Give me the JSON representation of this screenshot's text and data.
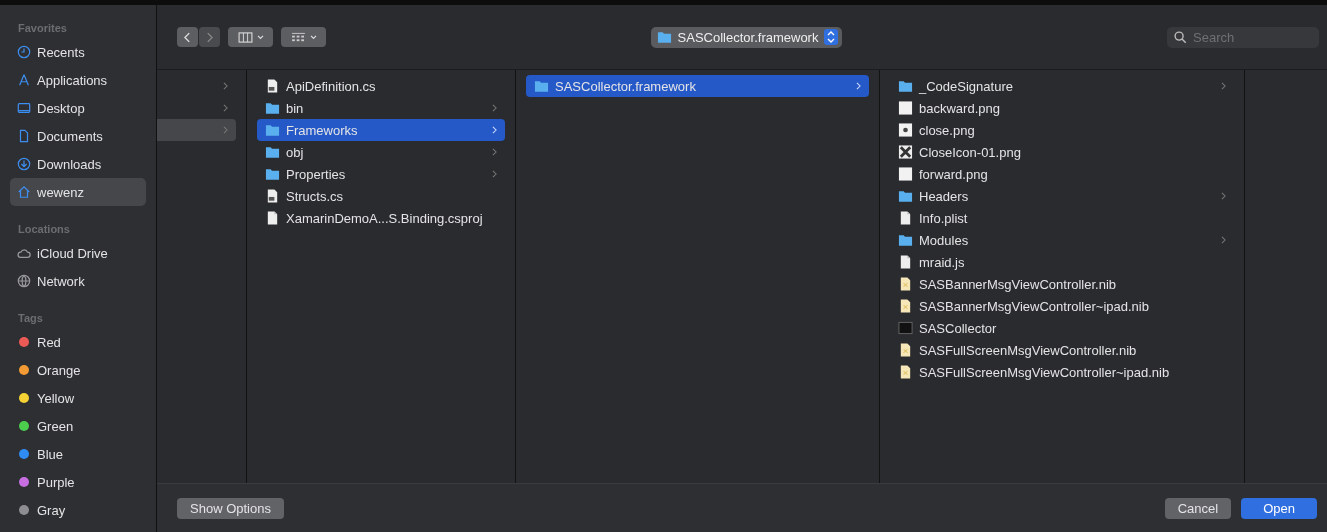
{
  "sidebar": {
    "sections": [
      {
        "title": "Favorites",
        "items": [
          {
            "label": "Recents",
            "kind": "clock",
            "selected": false
          },
          {
            "label": "Applications",
            "kind": "apps",
            "selected": false
          },
          {
            "label": "Desktop",
            "kind": "desktop",
            "selected": false
          },
          {
            "label": "Documents",
            "kind": "doc",
            "selected": false
          },
          {
            "label": "Downloads",
            "kind": "download",
            "selected": false
          },
          {
            "label": "wewenz",
            "kind": "home",
            "selected": true
          }
        ]
      },
      {
        "title": "Locations",
        "items": [
          {
            "label": "iCloud Drive",
            "kind": "cloud",
            "selected": false
          },
          {
            "label": "Network",
            "kind": "globe",
            "selected": false
          }
        ]
      },
      {
        "title": "Tags",
        "items": [
          {
            "label": "Red",
            "color": "#ec5a56",
            "selected": false
          },
          {
            "label": "Orange",
            "color": "#f29a33",
            "selected": false
          },
          {
            "label": "Yellow",
            "color": "#f5d133",
            "selected": false
          },
          {
            "label": "Green",
            "color": "#4ccd4d",
            "selected": false
          },
          {
            "label": "Blue",
            "color": "#2f8cf5",
            "selected": false
          },
          {
            "label": "Purple",
            "color": "#c76ee0",
            "selected": false
          },
          {
            "label": "Gray",
            "color": "#8e8e92",
            "selected": false
          }
        ]
      }
    ]
  },
  "toolbar": {
    "path": "SASCollector.framework",
    "search": {
      "placeholder": "Search"
    }
  },
  "columns": [
    {
      "active": false,
      "items": [
        {
          "selected": false,
          "expandable": true
        },
        {
          "selected": false,
          "expandable": true
        },
        {
          "selected": true,
          "expandable": true
        }
      ]
    },
    {
      "items": [
        {
          "label": "ApiDefinition.cs",
          "kind": "cs",
          "selected": false,
          "expandable": false
        },
        {
          "label": "bin",
          "kind": "folder",
          "selected": false,
          "expandable": true
        },
        {
          "label": "Frameworks",
          "kind": "folder",
          "selected": true,
          "expandable": true
        },
        {
          "label": "obj",
          "kind": "folder",
          "selected": false,
          "expandable": true
        },
        {
          "label": "Properties",
          "kind": "folder",
          "selected": false,
          "expandable": true
        },
        {
          "label": "Structs.cs",
          "kind": "cs",
          "selected": false,
          "expandable": false
        },
        {
          "label": "XamarinDemoA...S.Binding.csproj",
          "kind": "doc",
          "selected": false,
          "expandable": false
        }
      ]
    },
    {
      "items": [
        {
          "label": "SASCollector.framework",
          "kind": "folder",
          "selected": true,
          "expandable": true
        }
      ]
    },
    {
      "items": [
        {
          "label": "_CodeSignature",
          "kind": "folder",
          "selected": false,
          "expandable": true
        },
        {
          "label": "backward.png",
          "kind": "image",
          "selected": false,
          "expandable": false
        },
        {
          "label": "close.png",
          "kind": "image-dot",
          "selected": false,
          "expandable": false
        },
        {
          "label": "CloseIcon-01.png",
          "kind": "image-x",
          "selected": false,
          "expandable": false
        },
        {
          "label": "forward.png",
          "kind": "image",
          "selected": false,
          "expandable": false
        },
        {
          "label": "Headers",
          "kind": "folder",
          "selected": false,
          "expandable": true
        },
        {
          "label": "Info.plist",
          "kind": "doc",
          "selected": false,
          "expandable": false
        },
        {
          "label": "Modules",
          "kind": "folder",
          "selected": false,
          "expandable": true
        },
        {
          "label": "mraid.js",
          "kind": "doc",
          "selected": false,
          "expandable": false
        },
        {
          "label": "SASBannerMsgViewController.nib",
          "kind": "nib",
          "selected": false,
          "expandable": false
        },
        {
          "label": "SASBannerMsgViewController~ipad.nib",
          "kind": "nib",
          "selected": false,
          "expandable": false
        },
        {
          "label": "SASCollector",
          "kind": "exec",
          "selected": false,
          "expandable": false
        },
        {
          "label": "SASFullScreenMsgViewController.nib",
          "kind": "nib",
          "selected": false,
          "expandable": false
        },
        {
          "label": "SASFullScreenMsgViewController~ipad.nib",
          "kind": "nib",
          "selected": false,
          "expandable": false
        }
      ]
    }
  ],
  "footer": {
    "options_button": "Show Options",
    "cancel_button": "Cancel",
    "open_button": "Open"
  }
}
